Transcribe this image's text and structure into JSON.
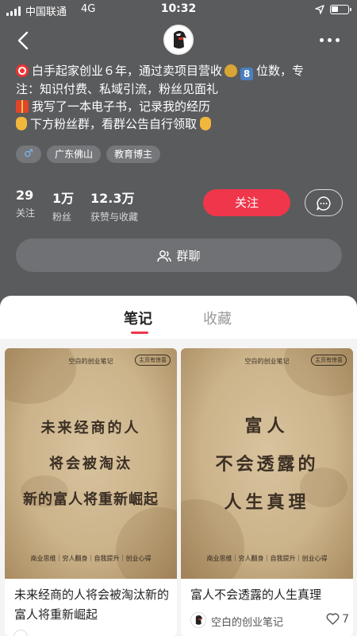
{
  "status_bar": {
    "carrier": "中国联通",
    "network": "4G",
    "time": "10:32"
  },
  "profile": {
    "bio_lines": [
      "白手起家创业６年，通过卖项目营收",
      "位数，专",
      "注：知识付费、私域引流，粉丝见面礼",
      "我写了一本电子书，记录我的经历",
      "下方粉丝群，看群公告自行领取"
    ],
    "tags": {
      "gender_symbol": "♂",
      "location": "广东佛山",
      "role": "教育博主"
    },
    "stats": [
      {
        "value": "29",
        "label": "关注"
      },
      {
        "value": "1万",
        "label": "粉丝"
      },
      {
        "value": "12.3万",
        "label": "获赞与收藏"
      }
    ],
    "follow_label": "关注",
    "group_chat_label": "群聊"
  },
  "tabs": {
    "notes": "笔记",
    "favorites": "收藏",
    "active": "notes"
  },
  "notes": [
    {
      "cover_brand": "空白的创业笔记",
      "cover_badge": "主页有惊喜",
      "cover_lines": [
        "未来经商的人",
        "将会被淘汰",
        "新的富人将重新崛起"
      ],
      "cover_footer": "商业思维｜穷人翻身｜自我提升｜创业心得",
      "title": "未来经商的人将会被淘汰新的富人将重新崛起"
    },
    {
      "cover_brand": "空白的创业笔记",
      "cover_badge": "主页有惊喜",
      "cover_lines": [
        "富人",
        "不会透露的",
        "人生真理"
      ],
      "cover_footer": "商业思维｜穷人翻身｜自我提升｜创业心得",
      "title": "富人不会透露的人生真理",
      "author": "空白的创业笔记",
      "likes": "7"
    }
  ],
  "colors": {
    "header_bg": "#5a5b5d",
    "accent": "#f0364a"
  },
  "icons": [
    "back-arrow-icon",
    "more-dots-icon",
    "chat-bubble-icon",
    "group-users-icon",
    "heart-icon",
    "location-arrow-icon",
    "battery-icon",
    "signal-icon"
  ]
}
